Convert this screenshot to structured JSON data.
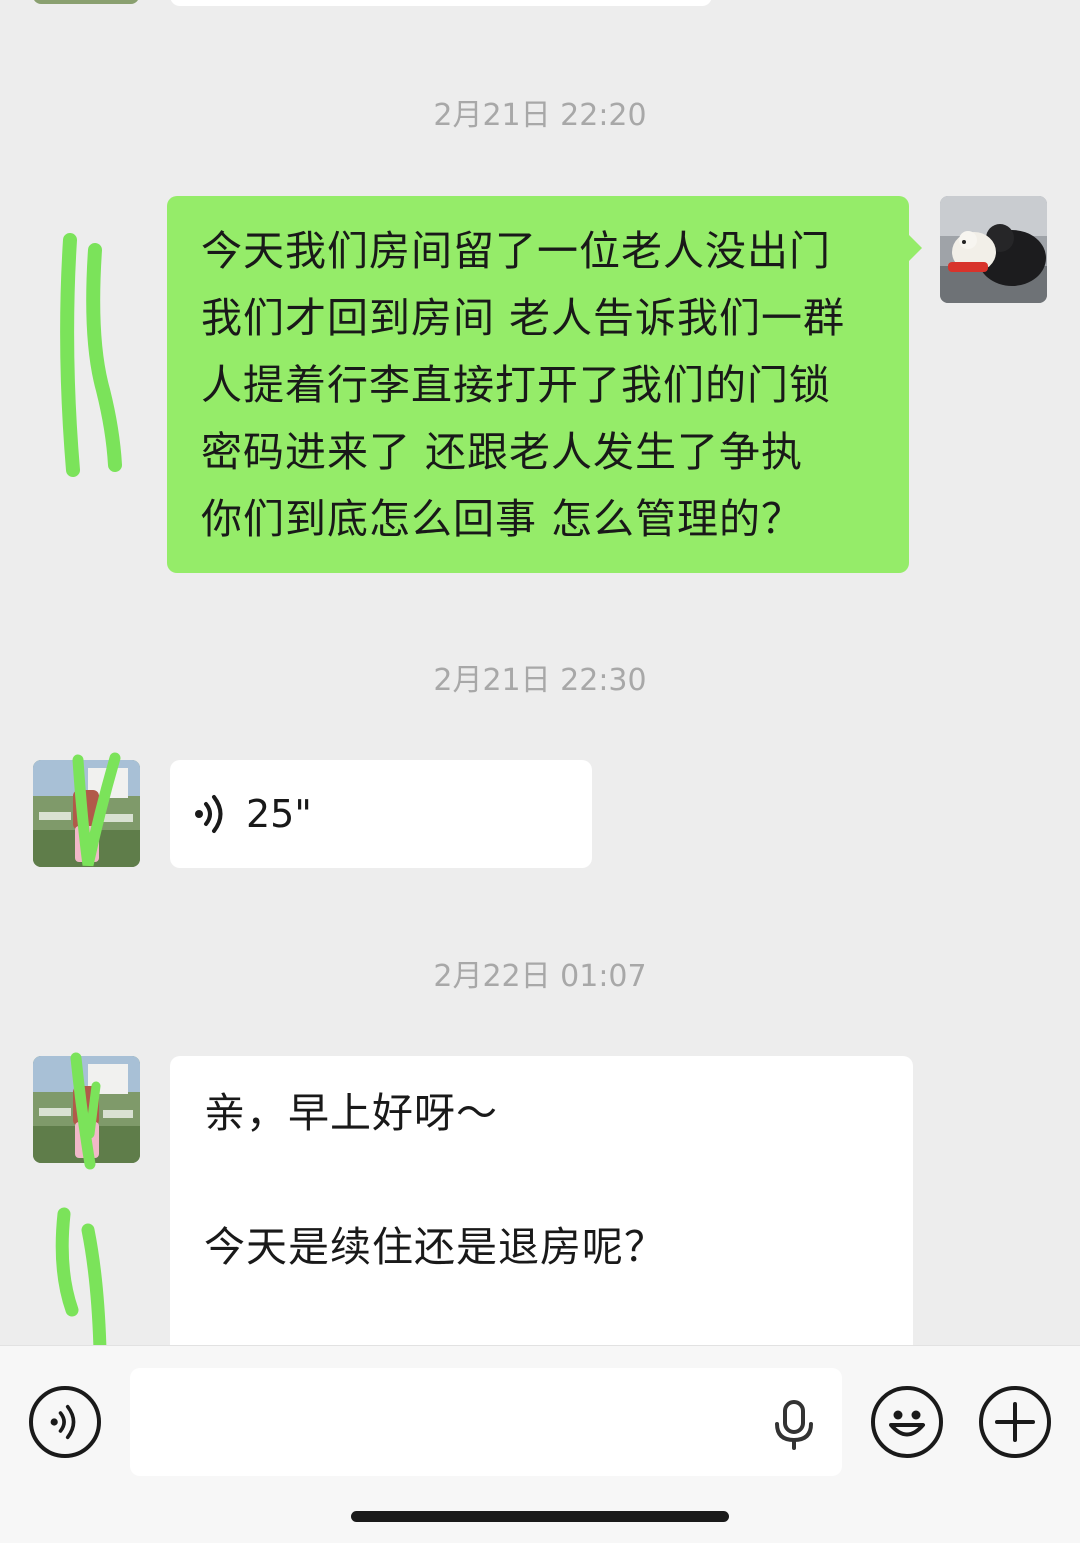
{
  "colors": {
    "background": "#ededed",
    "sent_bubble": "#95ec69",
    "received_bubble": "#ffffff",
    "timestamp_text": "#a8a8a8",
    "scribble": "#7be35a"
  },
  "messages": [
    {
      "type": "timestamp",
      "text": "2月21日 22:20"
    },
    {
      "type": "sent_text",
      "text": "今天我们房间留了一位老人没出门\n我们才回到房间 老人告诉我们一群\n人提着行李直接打开了我们的门锁\n密码进来了 还跟老人发生了争执\n你们到底怎么回事 怎么管理的？",
      "avatar_icon": "dog-avatar-icon"
    },
    {
      "type": "timestamp",
      "text": "2月21日 22:30"
    },
    {
      "type": "received_voice",
      "duration": "25\"",
      "icon": "voice-wave-icon",
      "avatar_icon": "hotel-avatar-icon"
    },
    {
      "type": "timestamp",
      "text": "2月22日 01:07"
    },
    {
      "type": "received_text",
      "text": "亲，早上好呀～\n\n今天是续住还是退房呢？",
      "avatar_icon": "hotel-avatar-icon"
    }
  ],
  "input_bar": {
    "voice_toggle_icon": "voice-mode-icon",
    "input_value": "",
    "mic_icon": "microphone-icon",
    "emoji_icon": "emoji-icon",
    "more_icon": "plus-icon"
  }
}
